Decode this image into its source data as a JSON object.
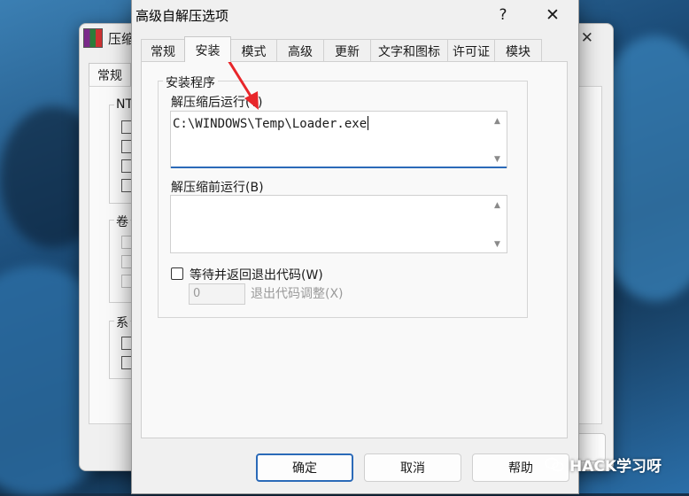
{
  "back_window": {
    "title": "压缩",
    "tab_label": "常规",
    "group_labels": [
      "NT",
      "卷",
      "系"
    ]
  },
  "dialog": {
    "title": "高级自解压选项",
    "help_label": "?",
    "close_label": "✕",
    "tabs": [
      {
        "label": "常规",
        "active": false
      },
      {
        "label": "安装",
        "active": true
      },
      {
        "label": "模式",
        "active": false
      },
      {
        "label": "高级",
        "active": false
      },
      {
        "label": "更新",
        "active": false
      },
      {
        "label": "文字和图标",
        "active": false
      },
      {
        "label": "许可证",
        "active": false
      },
      {
        "label": "模块",
        "active": false
      }
    ],
    "setup": {
      "group_label": "安装程序",
      "run_after_label": "解压缩后运行(T)",
      "run_after_value": "C:\\WINDOWS\\Temp\\Loader.exe",
      "run_before_label": "解压缩前运行(B)",
      "run_before_value": "",
      "wait_checkbox_label": "等待并返回退出代码(W)",
      "wait_checked": false,
      "exit_code_value": "0",
      "exit_code_label": "退出代码调整(X)"
    },
    "buttons": {
      "ok": "确定",
      "cancel": "取消",
      "help": "帮助"
    }
  },
  "annotation": {
    "arrow_color": "#e8262a"
  },
  "watermark": "HACK学习呀",
  "colors": {
    "accent": "#2b6ab8",
    "dialog_bg": "#f0f0f0"
  }
}
